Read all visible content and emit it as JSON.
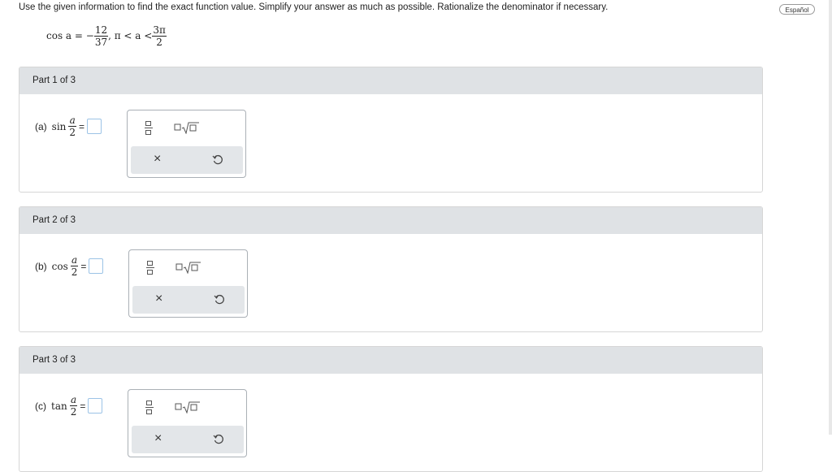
{
  "instructions": "Use the given information to find the exact function value. Simplify your answer as much as possible. Rationalize the denominator if necessary.",
  "language_button": "Español",
  "given": {
    "lhs": "cos a = −",
    "frac_num": "12",
    "frac_den": "37",
    "mid": ", π < a <",
    "range_num": "3π",
    "range_den": "2"
  },
  "parts": [
    {
      "header": "Part 1 of 3",
      "label": "(a)",
      "fn": "sin",
      "num": "a",
      "den": "2",
      "eq": "="
    },
    {
      "header": "Part 2 of 3",
      "label": "(b)",
      "fn": "cos",
      "num": "a",
      "den": "2",
      "eq": "="
    },
    {
      "header": "Part 3 of 3",
      "label": "(c)",
      "fn": "tan",
      "num": "a",
      "den": "2",
      "eq": "="
    }
  ],
  "palette": {
    "fraction_icon": "fraction-template-icon",
    "sqrt_icon": "square-root-template-icon",
    "clear_icon": "clear-icon",
    "clear_symbol": "×",
    "undo_icon": "undo-icon"
  },
  "colors": {
    "header_bg": "#dfe2e5",
    "answer_border": "#9cc3e6",
    "palette_border": "#aab0b6"
  }
}
